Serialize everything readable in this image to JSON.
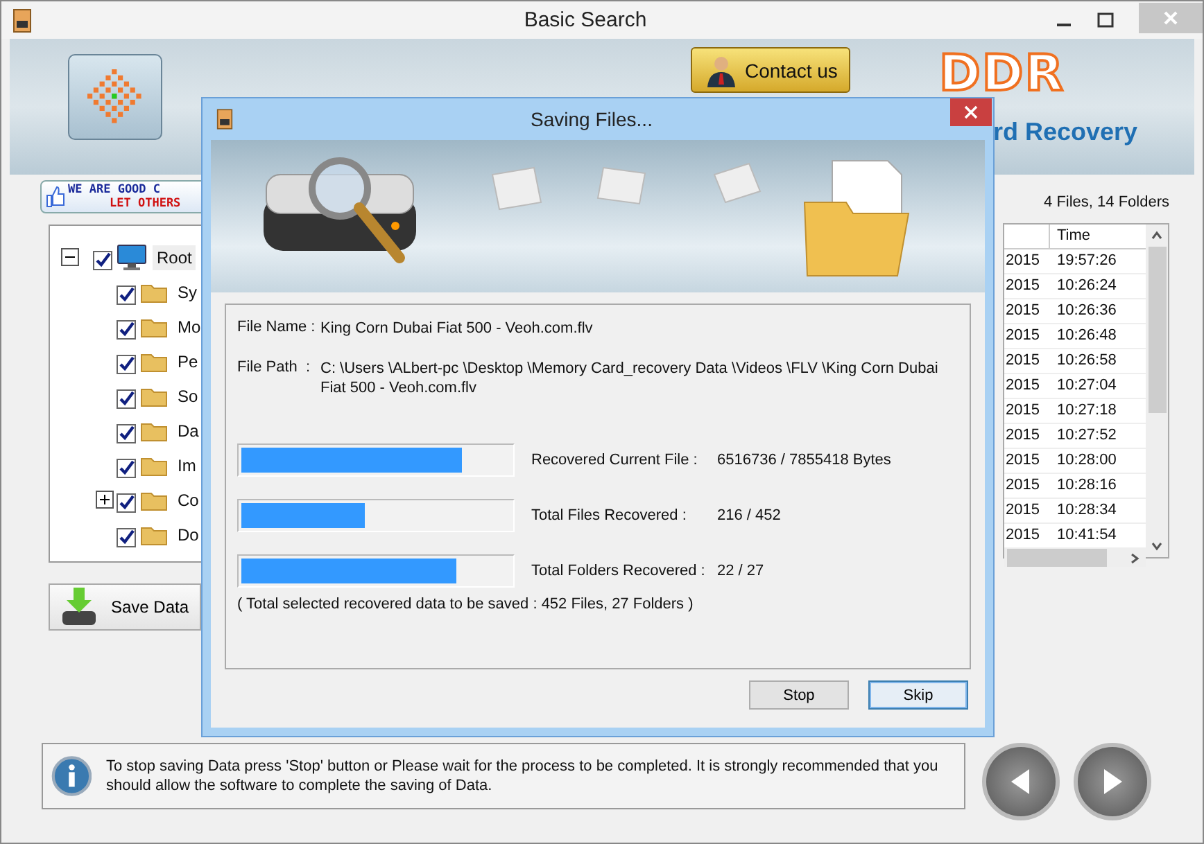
{
  "window": {
    "title": "Basic Search"
  },
  "header": {
    "contact_button": "Contact us",
    "brand": "DDR",
    "product_fragment": "rd Recovery"
  },
  "promo": {
    "line_1": "WE ARE GOOD C",
    "line_2": "LET OTHERS"
  },
  "tree": {
    "label": "Root",
    "expanded": true,
    "checked": true,
    "selected": true,
    "children": [
      {
        "label": "Sy",
        "kind": "folder",
        "checked": true,
        "selected": false
      },
      {
        "label": "Mo",
        "kind": "folder",
        "checked": true,
        "selected": false
      },
      {
        "label": "Pe",
        "kind": "folder",
        "checked": true,
        "selected": false
      },
      {
        "label": "So",
        "kind": "folder",
        "checked": true,
        "selected": false
      },
      {
        "label": "Da",
        "kind": "folder",
        "checked": true,
        "selected": false
      },
      {
        "label": "Im",
        "kind": "folder",
        "checked": true,
        "selected": false
      },
      {
        "label": "Co",
        "kind": "collapsed-folder",
        "checked": true,
        "selected": false
      },
      {
        "label": "Do",
        "kind": "folder",
        "checked": true,
        "selected": false
      }
    ]
  },
  "save_button": "Save Data",
  "summary": "4 Files, 14 Folders",
  "table": {
    "columns": [
      "Time"
    ],
    "rows": [
      {
        "date": "2015",
        "time": "19:57:26"
      },
      {
        "date": "2015",
        "time": "10:26:24"
      },
      {
        "date": "2015",
        "time": "10:26:36"
      },
      {
        "date": "2015",
        "time": "10:26:48"
      },
      {
        "date": "2015",
        "time": "10:26:58"
      },
      {
        "date": "2015",
        "time": "10:27:04"
      },
      {
        "date": "2015",
        "time": "10:27:18"
      },
      {
        "date": "2015",
        "time": "10:27:52"
      },
      {
        "date": "2015",
        "time": "10:28:00"
      },
      {
        "date": "2015",
        "time": "10:28:16"
      },
      {
        "date": "2015",
        "time": "10:28:34"
      },
      {
        "date": "2015",
        "time": "10:41:54"
      }
    ]
  },
  "info": "To stop saving Data press 'Stop' button or Please wait for the process to be completed. It is strongly recommended that you should allow the software to complete the saving of Data.",
  "dialog": {
    "title": "Saving Files...",
    "file_name_label": "File Name :",
    "file_name": "King Corn Dubai Fiat 500 - Veoh.com.flv",
    "file_path_label": "File Path  :",
    "file_path": "C: \\Users \\ALbert-pc \\Desktop \\Memory Card_recovery Data \\Videos \\FLV \\King Corn Dubai Fiat 500 - Veoh.com.flv",
    "progress": [
      {
        "label": "Recovered Current File :",
        "reading": "6516736 / 7855418 Bytes",
        "level": 0.82
      },
      {
        "label": "Total Files Recovered :",
        "reading": "216 / 452",
        "level": 0.46
      },
      {
        "label": "Total Folders Recovered :",
        "reading": "22 / 27",
        "level": 0.8
      }
    ],
    "total": "( Total selected recovered data to be saved : 452 Files, 27 Folders )",
    "buttons": [
      {
        "label": "Stop",
        "selected": false
      },
      {
        "label": "Skip",
        "selected": true
      }
    ]
  }
}
